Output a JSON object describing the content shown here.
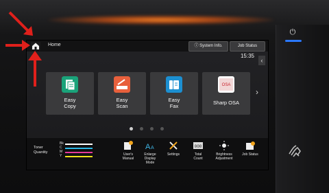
{
  "header": {
    "home_label": "Home",
    "system_info": "System Info.",
    "job_status": "Job Status",
    "clock": "15:35"
  },
  "tiles": [
    {
      "label_line1": "Easy",
      "label_line2": "Copy",
      "color": "#1aa37a"
    },
    {
      "label_line1": "Easy",
      "label_line2": "Scan",
      "color": "#e8603c"
    },
    {
      "label_line1": "Easy",
      "label_line2": "Fax",
      "color": "#1c8fd1"
    },
    {
      "label_line1": "Sharp OSA",
      "label_line2": "",
      "color": "#ffffff"
    }
  ],
  "toner": {
    "label_line1": "Toner",
    "label_line2": "Quantity",
    "rows": [
      {
        "key": "Bk",
        "color": "#ffffff"
      },
      {
        "key": "C",
        "color": "#2bb7e6"
      },
      {
        "key": "M",
        "color": "#e5399a"
      },
      {
        "key": "Y",
        "color": "#f2e21a"
      }
    ]
  },
  "bottom_items": [
    {
      "line1": "User's",
      "line2": "Manual",
      "line3": ""
    },
    {
      "line1": "Enlarge",
      "line2": "Display",
      "line3": "Mode"
    },
    {
      "line1": "Settings",
      "line2": "",
      "line3": ""
    },
    {
      "line1": "Total",
      "line2": "Count",
      "line3": ""
    },
    {
      "line1": "Brightness",
      "line2": "Adjustment",
      "line3": ""
    },
    {
      "line1": "Job Status",
      "line2": "",
      "line3": ""
    }
  ],
  "accent": {
    "arrow": "#e0201b",
    "led": "#2a78ff",
    "glow": "#ff8a28"
  },
  "pages": {
    "total": 4,
    "current": 1
  }
}
